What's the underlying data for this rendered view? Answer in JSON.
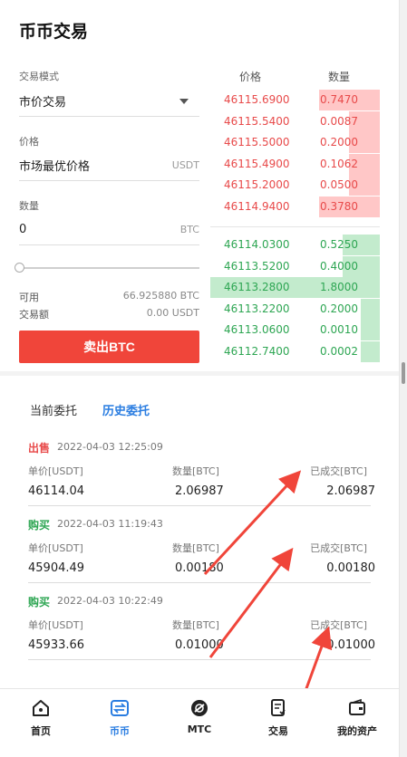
{
  "page_title": "币币交易",
  "form": {
    "mode_label": "交易模式",
    "mode_value": "市价交易",
    "price_label": "价格",
    "price_value": "市场最优价格",
    "price_unit": "USDT",
    "qty_label": "数量",
    "qty_value": "0",
    "qty_unit": "BTC",
    "slider_percent": 0,
    "available_label": "可用",
    "available_value": "66.925880 BTC",
    "amount_label": "交易额",
    "amount_value": "0.00 USDT",
    "submit_label": "卖出BTC"
  },
  "orderbook": {
    "price_header": "价格",
    "qty_header": "数量",
    "asks": [
      {
        "price": "46115.6900",
        "qty": "0.7470",
        "depth": 0.36
      },
      {
        "price": "46115.5400",
        "qty": "0.0087",
        "depth": 0.18
      },
      {
        "price": "46115.5000",
        "qty": "0.2000",
        "depth": 0.18
      },
      {
        "price": "46115.4900",
        "qty": "0.1062",
        "depth": 0.18
      },
      {
        "price": "46115.2000",
        "qty": "0.0500",
        "depth": 0.18
      },
      {
        "price": "46114.9400",
        "qty": "0.3780",
        "depth": 0.36
      }
    ],
    "bids": [
      {
        "price": "46114.0300",
        "qty": "0.5250",
        "depth": 0.22
      },
      {
        "price": "46113.5200",
        "qty": "0.4000",
        "depth": 0.22
      },
      {
        "price": "46113.2800",
        "qty": "1.8000",
        "depth": 1.0
      },
      {
        "price": "46113.2200",
        "qty": "0.2000",
        "depth": 0.11
      },
      {
        "price": "46113.0600",
        "qty": "0.0010",
        "depth": 0.11
      },
      {
        "price": "46112.7400",
        "qty": "0.0002",
        "depth": 0.11
      }
    ],
    "ask_color": "#e84a4a",
    "bid_color": "#2ea653"
  },
  "tabs": {
    "current": "当前委托",
    "history": "历史委托"
  },
  "orders": [
    {
      "side": "出售",
      "side_color": "#e84a4a",
      "time": "2022-04-03 12:25:09",
      "price_label": "单价[USDT]",
      "qty_label": "数量[BTC]",
      "filled_label": "已成交[BTC]",
      "price": "46114.04",
      "qty": "2.06987",
      "filled": "2.06987"
    },
    {
      "side": "购买",
      "side_color": "#2ea653",
      "time": "2022-04-03 11:19:43",
      "price_label": "单价[USDT]",
      "qty_label": "数量[BTC]",
      "filled_label": "已成交[BTC]",
      "price": "45904.49",
      "qty": "0.00180",
      "filled": "0.00180"
    },
    {
      "side": "购买",
      "side_color": "#2ea653",
      "time": "2022-04-03 10:22:49",
      "price_label": "单价[USDT]",
      "qty_label": "数量[BTC]",
      "filled_label": "已成交[BTC]",
      "price": "45933.66",
      "qty": "0.01000",
      "filled": "0.01000"
    }
  ],
  "nav": [
    {
      "label": "首页",
      "icon": "home-icon"
    },
    {
      "label": "币币",
      "icon": "exchange-icon",
      "active": true
    },
    {
      "label": "MTC",
      "icon": "mtc-icon"
    },
    {
      "label": "交易",
      "icon": "document-icon"
    },
    {
      "label": "我的资产",
      "icon": "wallet-icon"
    }
  ],
  "accent_color": "#2a7de1",
  "sell_button_color": "#f0453a"
}
